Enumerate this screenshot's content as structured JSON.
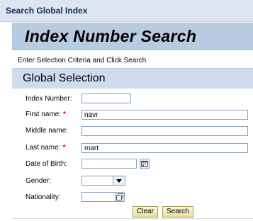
{
  "window": {
    "title": "Search Global Index"
  },
  "banner": {
    "title": "Index Number Search"
  },
  "instruction": "Enter Selection Criteria and Click Search",
  "group": {
    "title": "Global Selection"
  },
  "fields": {
    "index_number": {
      "label": "Index Number:",
      "value": ""
    },
    "first_name": {
      "label": "First name:",
      "value": "navr",
      "required_mark": "*"
    },
    "middle_name": {
      "label": "Middle name:",
      "value": ""
    },
    "last_name": {
      "label": "Last name:",
      "value": "mart",
      "required_mark": "*"
    },
    "date_of_birth": {
      "label": "Date of Birth:",
      "value": ""
    },
    "gender": {
      "label": "Gender:",
      "value": ""
    },
    "nationality": {
      "label": "Nationality:",
      "value": ""
    }
  },
  "buttons": {
    "clear": "Clear",
    "search": "Search"
  },
  "icons": {
    "calendar": "calendar-icon",
    "dropdown": "chevron-down-icon",
    "value_help": "value-help-icon"
  },
  "colors": {
    "required": "#cc0000",
    "banner": "#b9cbe0",
    "header": "#dce6f1",
    "button": "#eadf9e"
  }
}
